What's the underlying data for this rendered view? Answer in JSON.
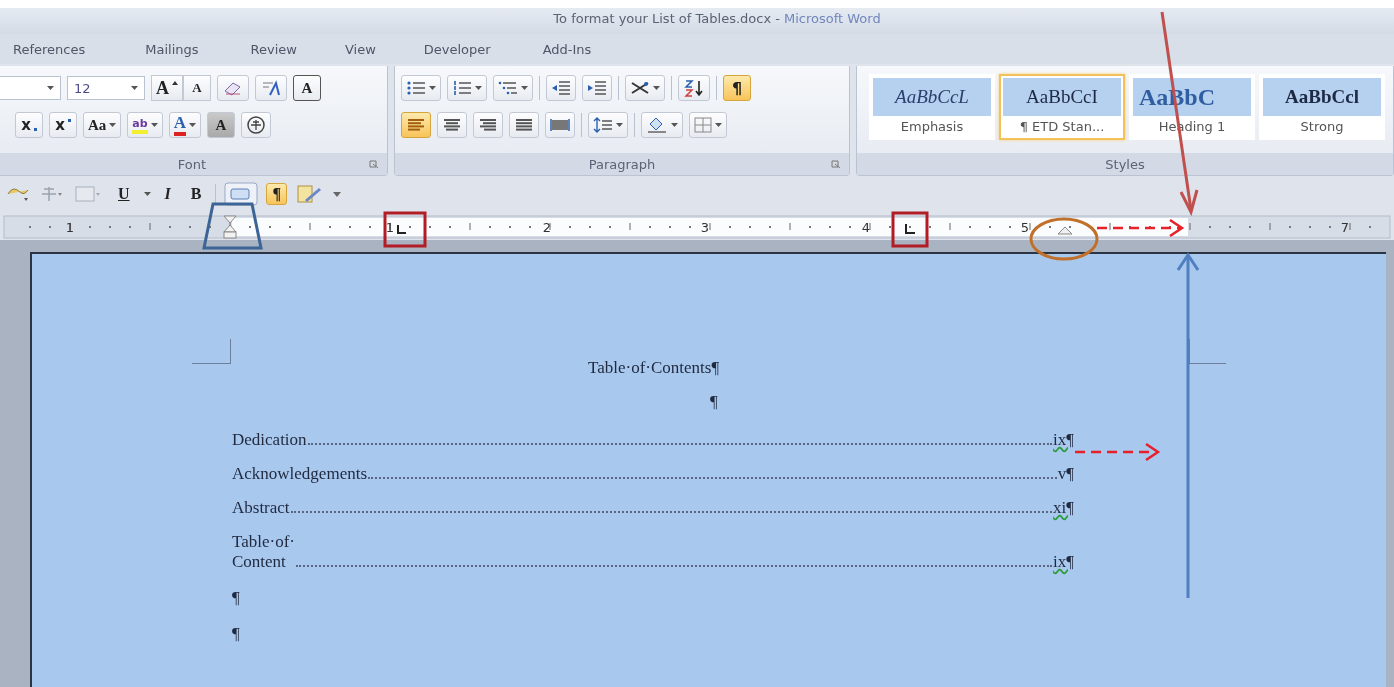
{
  "window": {
    "title": "To format your List of Tables.docx - ",
    "app_name": "Microsoft Word"
  },
  "tabs": [
    {
      "label": "References",
      "selected": false
    },
    {
      "label": "Mailings",
      "selected": false
    },
    {
      "label": "Review",
      "selected": false
    },
    {
      "label": "View",
      "selected": false
    },
    {
      "label": "Developer",
      "selected": false
    },
    {
      "label": "Add-Ins",
      "selected": false
    }
  ],
  "font_group": {
    "label": "Font",
    "size": "12",
    "grow": "A",
    "shrink": "A",
    "border": "A",
    "subscript": "x",
    "superscript": "x",
    "case": "Aa",
    "highlight": "ab",
    "color_glyph": "A",
    "shade": "A"
  },
  "paragraph_group": {
    "label": "Paragraph",
    "show_marks": {
      "glyph": "¶",
      "on": true
    },
    "alignment": [
      {
        "kind": "left",
        "selected": true
      },
      {
        "kind": "center",
        "selected": false
      },
      {
        "kind": "right",
        "selected": false
      },
      {
        "kind": "justify",
        "selected": false
      }
    ]
  },
  "styles_group": {
    "label": "Styles",
    "items": [
      {
        "preview": "AaBbCcL",
        "name": "Emphasis",
        "kind": "emphasis",
        "selected": false
      },
      {
        "preview": "AaBbCcI",
        "name": "¶ ETD Stan...",
        "kind": "normal",
        "selected": true
      },
      {
        "preview": "AaBbC",
        "name": "Heading 1",
        "kind": "heading",
        "selected": false
      },
      {
        "preview": "AaBbCcl",
        "name": "Strong",
        "kind": "strong",
        "selected": false
      }
    ]
  },
  "quick_bar": {
    "underline": "U",
    "italic": "I",
    "bold": "B",
    "show_marks": {
      "glyph": "¶",
      "on": true
    }
  },
  "ruler": {
    "numbers": [
      "1",
      "1",
      "2",
      "3",
      "4",
      "5",
      "7"
    ]
  },
  "document": {
    "heading": "Table·of·Contents¶",
    "blank_mark": "¶",
    "entries": [
      {
        "title": "Dedication",
        "page": "ix¶",
        "flagged": true
      },
      {
        "title": "Acknowledgements",
        "page": "v¶",
        "flagged": false
      },
      {
        "title": "Abstract",
        "page": "xi¶",
        "flagged": true
      },
      {
        "title": "Table·of·\nContent",
        "page": "ix¶",
        "flagged": true
      }
    ],
    "end_marks": [
      "¶",
      "¶"
    ]
  }
}
